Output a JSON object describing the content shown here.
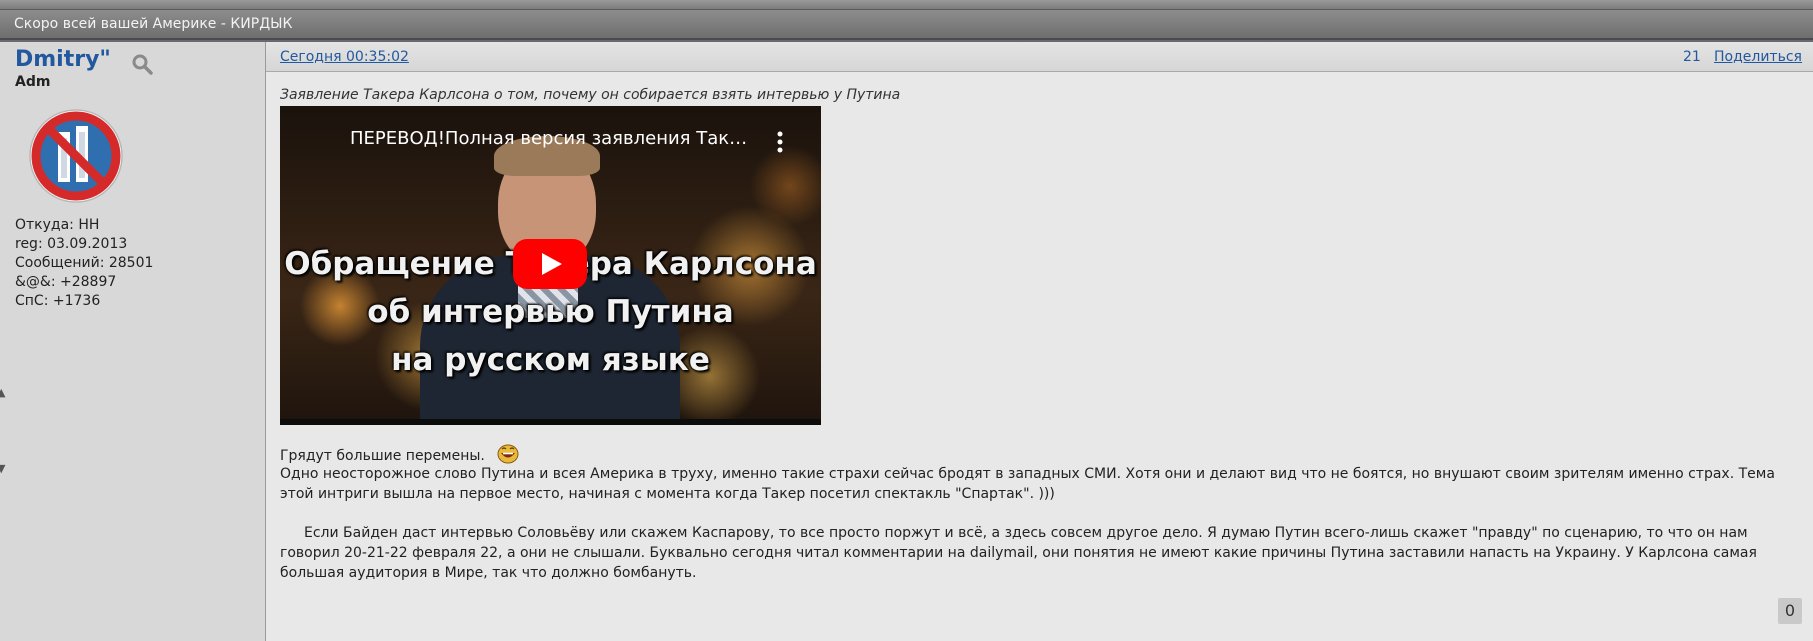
{
  "thread": {
    "title": "Скоро всей вашей Америке - КИРДЫК"
  },
  "author": {
    "name": "Dmitry\"",
    "role": "Adm",
    "info": [
      "Откуда: НН",
      "reg: 03.09.2013",
      "Сообщений: 28501",
      "&@&: +28897",
      "СпС: +1736"
    ]
  },
  "post": {
    "date": "Сегодня 00:35:02",
    "number": "21",
    "share_label": "Поделиться",
    "subtitle": "Заявление Такера Карлсона о том, почему он собирается взять интервью у Путина",
    "video": {
      "title": "ПЕРЕВОД!Полная версия заявления Такера Карлсона об интервью Путина",
      "caption": [
        "Обращение Такера Карлсона",
        "об интервью Путина",
        "на русском языке"
      ]
    },
    "body": [
      "Грядут большие перемены.",
      "Одно неосторожное слово Путина и всея Америка в труху, именно такие страхи сейчас бродят в западных СМИ. Хотя они и делают вид что не боятся, но внушают своим зрителям именно страх. Тема этой интриги вышла на первое место, начиная с момента когда Такер посетил спектакль \"Спартак\". )))",
      "Если Байден даст интервью Соловьёву или скажем Каспарову, то все просто поржут и всё, а здесь совсем другое дело. Я думаю Путин всего-лишь скажет \"правду\" по сценарию, то что он нам говорил 20-21-22 февраля 22, а они не слышали. Буквально сегодня читал комментарии на dailymail, они понятия не имеют какие причины Путина заставили напасть на Украину. У Карлсона самая большая аудитория в Мире, так что должно бомбануть."
    ],
    "reactions_count": "0"
  }
}
